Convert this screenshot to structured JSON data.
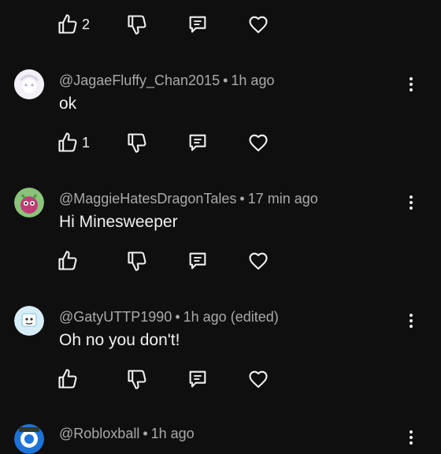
{
  "top_actions": {
    "like_count": "2"
  },
  "comments": [
    {
      "author": "@JagaeFluffy_Chan2015",
      "time": "1h ago",
      "text": "ok",
      "like_count": "1",
      "avatar_colors": [
        "#f1eef5",
        "#d9cfe6"
      ]
    },
    {
      "author": "@MaggieHatesDragonTales",
      "time": "17 min ago",
      "text": "Hi Minesweeper",
      "like_count": "",
      "avatar_colors": [
        "#7ab56a",
        "#c23c7a"
      ]
    },
    {
      "author": "@GatyUTTP1990",
      "time": "1h ago (edited)",
      "text": "Oh no you don't!",
      "like_count": "",
      "avatar_colors": [
        "#bfe3f5",
        "#e9f5fb"
      ]
    },
    {
      "author": "@Robloxball",
      "time": "1h ago",
      "text": "",
      "like_count": "",
      "avatar_colors": [
        "#1e73d8",
        "#ffffff"
      ]
    }
  ],
  "separator": "•",
  "icons": [
    "like-icon",
    "dislike-icon",
    "reply-icon",
    "heart-icon",
    "more-vert-icon"
  ]
}
